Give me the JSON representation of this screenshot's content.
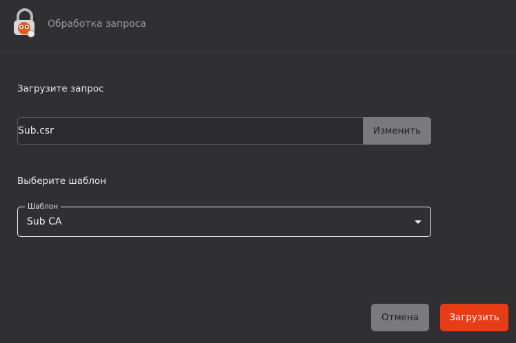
{
  "header": {
    "title": "Обработка запроса",
    "icon": "padlock-mascot-icon"
  },
  "upload_section": {
    "label": "Загрузите запрос",
    "file_value": "Sub.csr",
    "change_label": "Изменить"
  },
  "template_section": {
    "label": "Выберите шаблон",
    "select_legend": "Шаблон",
    "select_value": "Sub CA"
  },
  "footer": {
    "cancel_label": "Отмена",
    "upload_label": "Загрузить"
  },
  "colors": {
    "background": "#303032",
    "accent": "#e63d16",
    "secondary_button": "#7a7a7c"
  }
}
